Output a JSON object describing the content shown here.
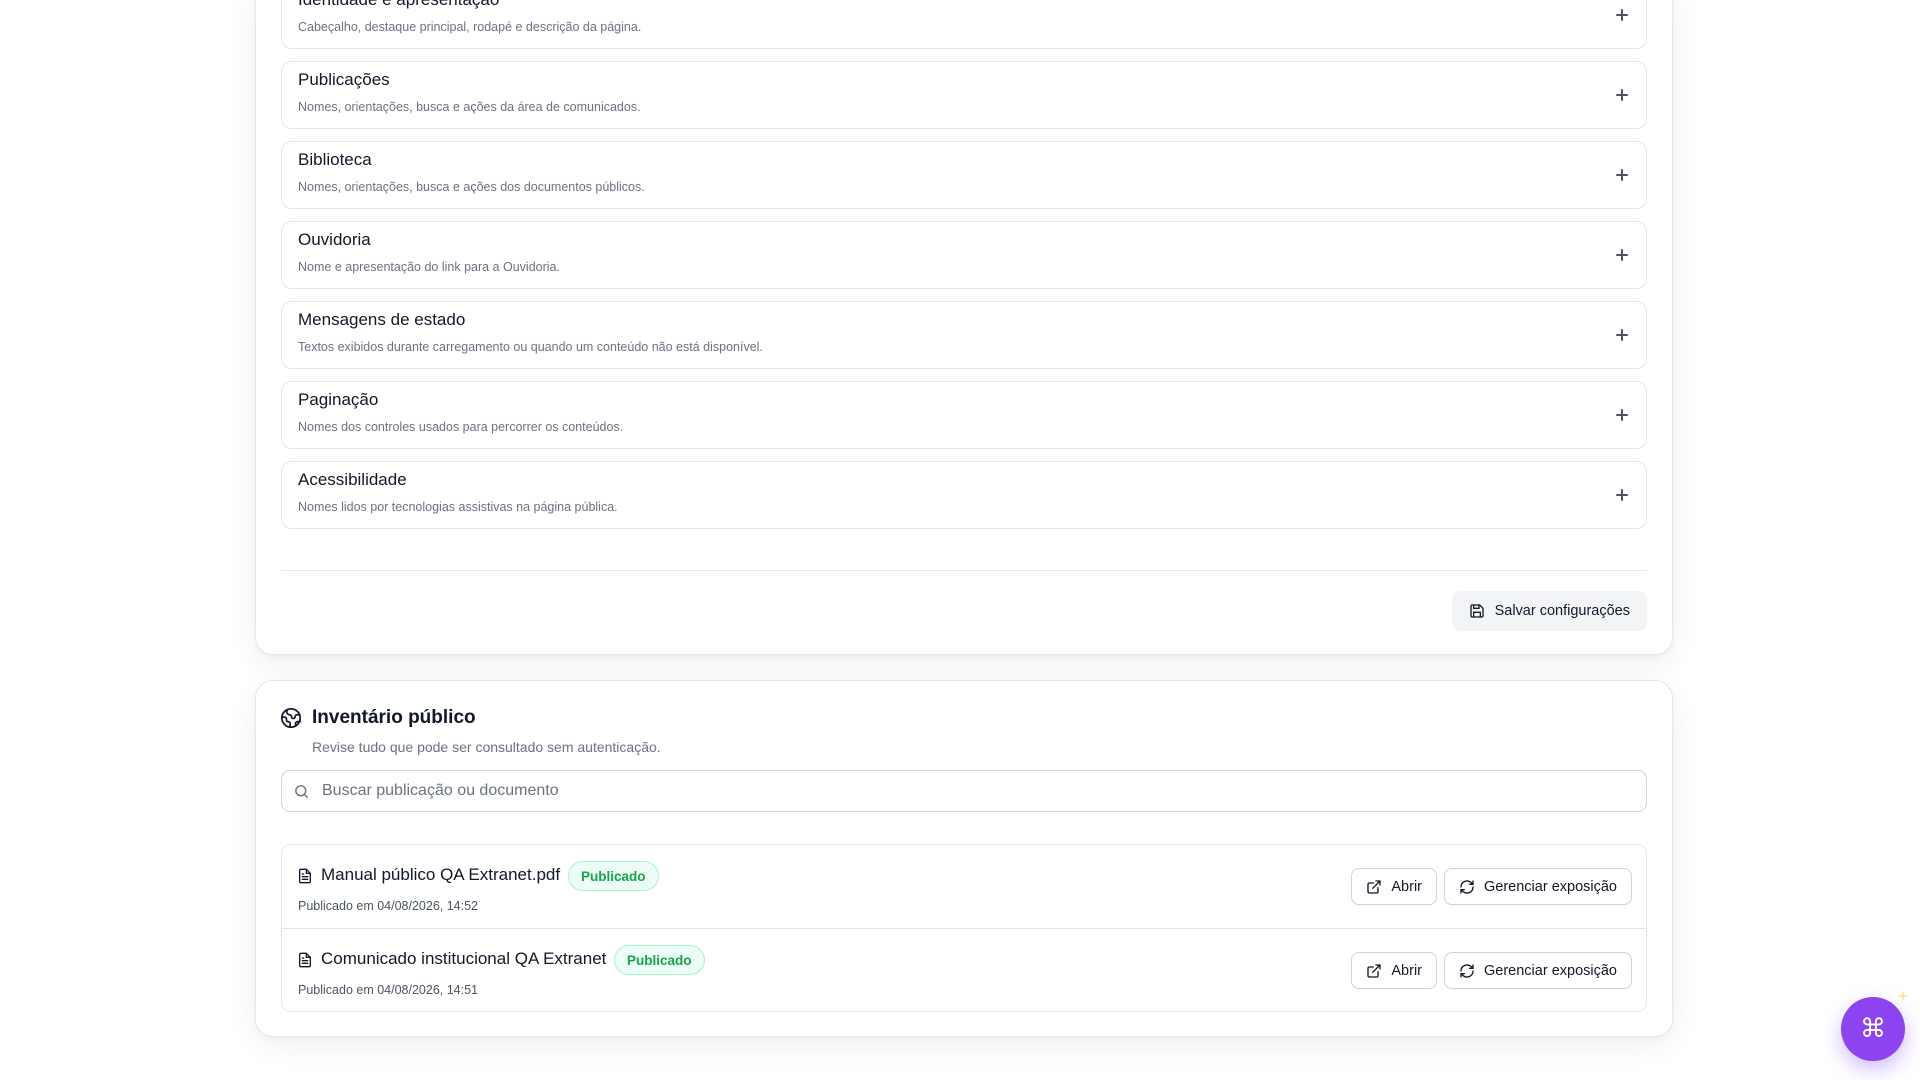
{
  "settings": {
    "sections": [
      {
        "title": "Identidade e apresentação",
        "description": "Cabeçalho, destaque principal, rodapé e descrição da página."
      },
      {
        "title": "Publicações",
        "description": "Nomes, orientações, busca e ações da área de comunicados."
      },
      {
        "title": "Biblioteca",
        "description": "Nomes, orientações, busca e ações dos documentos públicos."
      },
      {
        "title": "Ouvidoria",
        "description": "Nome e apresentação do link para a Ouvidoria."
      },
      {
        "title": "Mensagens de estado",
        "description": "Textos exibidos durante carregamento ou quando um conteúdo não está disponível."
      },
      {
        "title": "Paginação",
        "description": "Nomes dos controles usados para percorrer os conteúdos."
      },
      {
        "title": "Acessibilidade",
        "description": "Nomes lidos por tecnologias assistivas na página pública."
      }
    ],
    "save_label": "Salvar configurações"
  },
  "inventory": {
    "title": "Inventário público",
    "subtitle": "Revise tudo que pode ser consultado sem autenticação.",
    "search_placeholder": "Buscar publicação ou documento",
    "search_value": "",
    "items": [
      {
        "title": "Manual público QA Extranet.pdf",
        "status": "Publicado",
        "date": "Publicado em 04/08/2026, 14:52",
        "open_label": "Abrir",
        "manage_label": "Gerenciar exposição"
      },
      {
        "title": "Comunicado institucional QA Extranet",
        "status": "Publicado",
        "date": "Publicado em 04/08/2026, 14:51",
        "open_label": "Abrir",
        "manage_label": "Gerenciar exposição"
      }
    ]
  },
  "fab": {
    "glyph": "⌘",
    "icon": "command-icon"
  },
  "colors": {
    "accent": "#8b44f0",
    "status_green": "#16a34a",
    "status_green_bg": "#ecfdf5",
    "border": "#e5e7eb",
    "muted_text": "#6b7280"
  }
}
